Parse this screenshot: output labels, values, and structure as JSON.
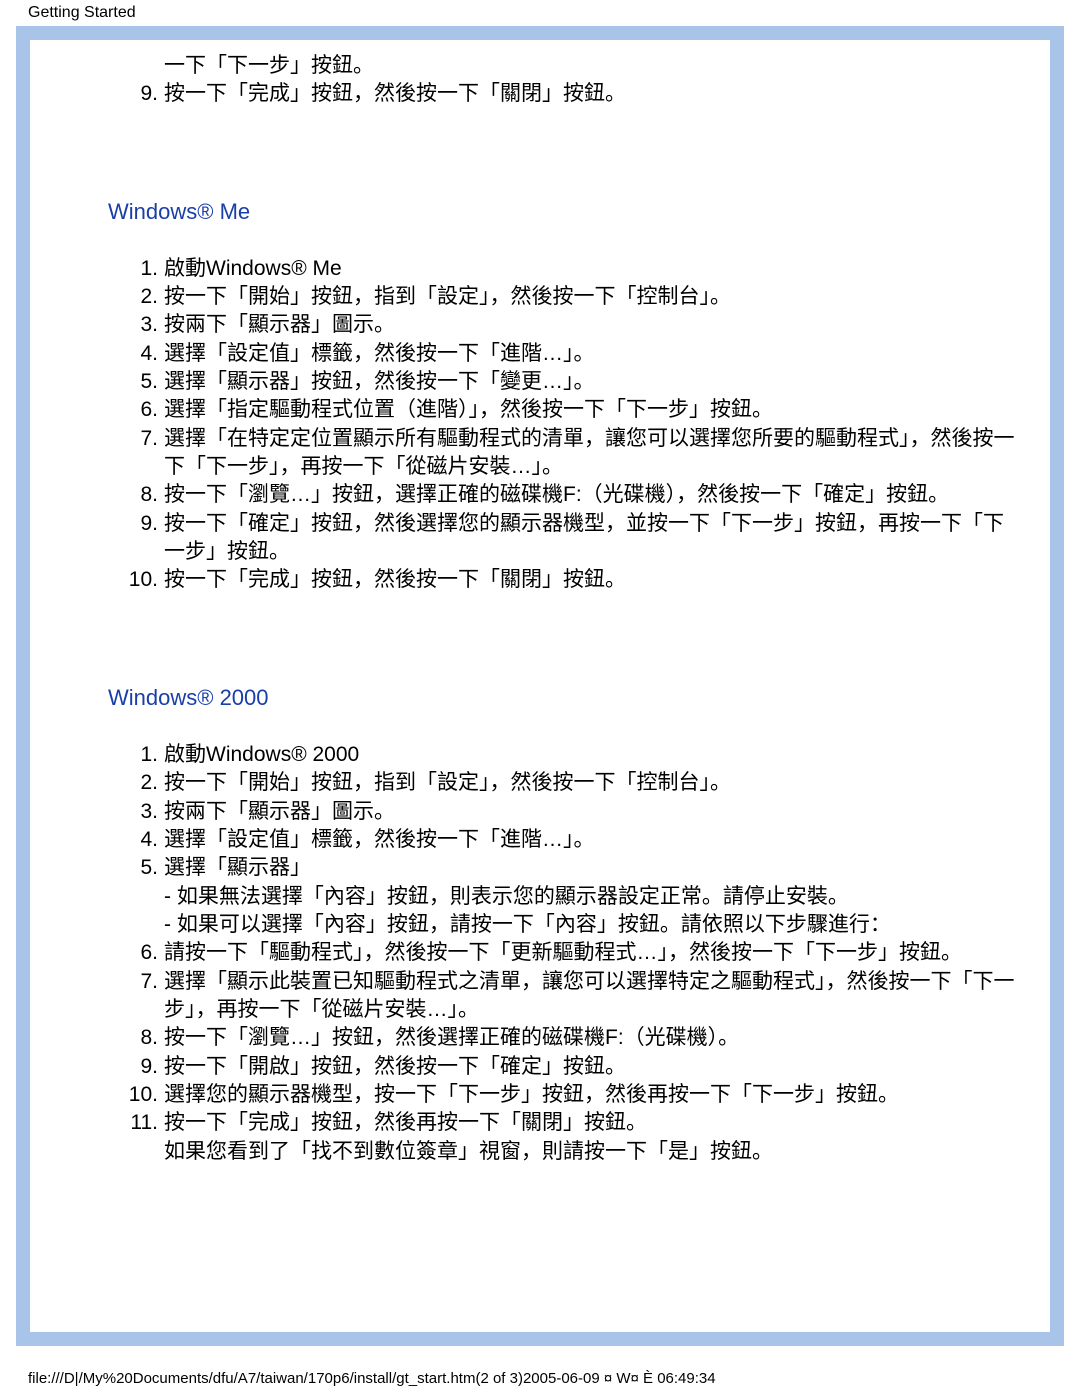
{
  "header": "Getting Started",
  "top_continuation": [
    {
      "num": "",
      "text": "一下「下一步」按鈕。"
    },
    {
      "num": "9.",
      "text": "按一下「完成」按鈕，然後按一下「關閉」按鈕。"
    }
  ],
  "sections": [
    {
      "title": "Windows® Me",
      "steps": [
        {
          "num": "1.",
          "text": "啟動Windows® Me"
        },
        {
          "num": "2.",
          "text": "按一下「開始」按鈕，指到「設定」，然後按一下「控制台」。"
        },
        {
          "num": "3.",
          "text": "按兩下「顯示器」圖示。"
        },
        {
          "num": "4.",
          "text": "選擇「設定值」標籤，然後按一下「進階…」。"
        },
        {
          "num": "5.",
          "text": "選擇「顯示器」按鈕，然後按一下「變更…」。"
        },
        {
          "num": "6.",
          "text": "選擇「指定驅動程式位置（進階）」，然後按一下「下一步」按鈕。"
        },
        {
          "num": "7.",
          "text": "選擇「在特定定位置顯示所有驅動程式的清單，讓您可以選擇您所要的驅動程式」，然後按一下「下一步」，再按一下「從磁片安裝…」。"
        },
        {
          "num": "8.",
          "text": "按一下「瀏覽…」按鈕，選擇正確的磁碟機F:（光碟機），然後按一下「確定」按鈕。"
        },
        {
          "num": "9.",
          "text": "按一下「確定」按鈕，然後選擇您的顯示器機型，並按一下「下一步」按鈕，再按一下「下一步」按鈕。"
        },
        {
          "num": "10.",
          "text": "按一下「完成」按鈕，然後按一下「關閉」按鈕。"
        }
      ]
    },
    {
      "title": "Windows® 2000",
      "steps": [
        {
          "num": "1.",
          "text": "啟動Windows® 2000"
        },
        {
          "num": "2.",
          "text": "按一下「開始」按鈕，指到「設定」，然後按一下「控制台」。"
        },
        {
          "num": "3.",
          "text": "按兩下「顯示器」圖示。"
        },
        {
          "num": "4.",
          "text": "選擇「設定值」標籤，然後按一下「進階…」。"
        },
        {
          "num": "5.",
          "text": "  選擇「顯示器」\n- 如果無法選擇「內容」按鈕，則表示您的顯示器設定正常。請停止安裝。\n- 如果可以選擇「內容」按鈕，請按一下「內容」按鈕。請依照以下步驟進行："
        },
        {
          "num": "6.",
          "text": "請按一下「驅動程式」，然後按一下「更新驅動程式…」，然後按一下「下一步」按鈕。"
        },
        {
          "num": "7.",
          "text": "選擇「顯示此裝置已知驅動程式之清單，讓您可以選擇特定之驅動程式」，然後按一下「下一步」，再按一下「從磁片安裝…」。"
        },
        {
          "num": "8.",
          "text": "按一下「瀏覽…」按鈕，然後選擇正確的磁碟機F:（光碟機）。"
        },
        {
          "num": "9.",
          "text": "按一下「開啟」按鈕，然後按一下「確定」按鈕。"
        },
        {
          "num": "10.",
          "text": "選擇您的顯示器機型，按一下「下一步」按鈕，然後再按一下「下一步」按鈕。"
        },
        {
          "num": "11.",
          "text": "按一下「完成」按鈕，然後再按一下「關閉」按鈕。\n如果您看到了「找不到數位簽章」視窗，則請按一下「是」按鈕。"
        }
      ]
    }
  ],
  "footer": "file:///D|/My%20Documents/dfu/A7/taiwan/170p6/install/gt_start.htm(2 of 3)2005-06-09 ¤ W¤ È 06:49:34"
}
